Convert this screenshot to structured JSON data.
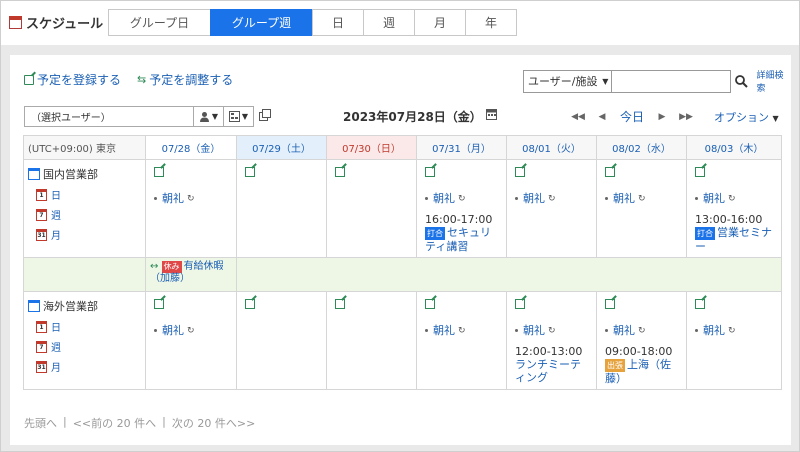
{
  "app": {
    "title": "スケジュール"
  },
  "view_tabs": [
    {
      "label": "グループ日",
      "active": false
    },
    {
      "label": "グループ週",
      "active": true
    },
    {
      "label": "日",
      "active": false
    },
    {
      "label": "週",
      "active": false
    },
    {
      "label": "月",
      "active": false
    },
    {
      "label": "年",
      "active": false
    }
  ],
  "actions": {
    "register": "予定を登録する",
    "adjust": "予定を調整する"
  },
  "search": {
    "select_value": "ユーザー/施設",
    "placeholder": "",
    "detail": "詳細検索"
  },
  "toolbar": {
    "user_select_value": "（選択ユーザー）",
    "date": "2023年07月28日（金）",
    "today": "今日",
    "option": "オプション"
  },
  "grid": {
    "timezone": "(UTC+09:00) 東京",
    "days": [
      {
        "label": "07/28（金）",
        "kind": "today"
      },
      {
        "label": "07/29（土）",
        "kind": "sat"
      },
      {
        "label": "07/30（日）",
        "kind": "sun"
      },
      {
        "label": "07/31（月）",
        "kind": "normal"
      },
      {
        "label": "08/01（火）",
        "kind": "normal"
      },
      {
        "label": "08/02（水）",
        "kind": "normal"
      },
      {
        "label": "08/03（木）",
        "kind": "normal"
      }
    ],
    "dept_links": {
      "day": "日",
      "week": "週",
      "month": "月",
      "day_num": "1",
      "week_num": "7",
      "month_num": "31"
    },
    "groups": [
      {
        "name": "国内営業部",
        "cells": [
          {
            "events": [
              {
                "title": "朝礼",
                "repeat": true
              }
            ]
          },
          {
            "events": []
          },
          {
            "events": []
          },
          {
            "events": [
              {
                "title": "朝礼",
                "repeat": true
              },
              {
                "time": "16:00-17:00",
                "tag": "打合",
                "title": "セキュリティ講習"
              }
            ]
          },
          {
            "events": [
              {
                "title": "朝礼",
                "repeat": true
              }
            ]
          },
          {
            "events": [
              {
                "title": "朝礼",
                "repeat": true
              }
            ]
          },
          {
            "events": [
              {
                "title": "朝礼",
                "repeat": true
              },
              {
                "time": "13:00-16:00",
                "tag": "打合",
                "title": "営業セミナー"
              }
            ]
          }
        ],
        "banner": {
          "tag": "休み",
          "title": "有給休暇（加藤）"
        }
      },
      {
        "name": "海外営業部",
        "cells": [
          {
            "events": [
              {
                "title": "朝礼",
                "repeat": true
              }
            ]
          },
          {
            "events": []
          },
          {
            "events": []
          },
          {
            "events": [
              {
                "title": "朝礼",
                "repeat": true
              }
            ]
          },
          {
            "events": [
              {
                "title": "朝礼",
                "repeat": true
              },
              {
                "time": "12:00-13:00",
                "title": "ランチミーティング"
              }
            ]
          },
          {
            "events": [
              {
                "title": "朝礼",
                "repeat": true
              },
              {
                "time": "09:00-18:00",
                "tag": "出張",
                "title": "上海（佐藤）"
              }
            ]
          },
          {
            "events": [
              {
                "title": "朝礼",
                "repeat": true
              }
            ]
          }
        ]
      }
    ]
  },
  "pager": {
    "first": "先頭へ",
    "prev": "<<前の 20 件へ",
    "next": "次の 20 件へ>>",
    "sep": "|"
  },
  "colors": {
    "accent": "#1a73e8",
    "link": "#1a5fb4",
    "banner_bg": "#eef6e6"
  }
}
